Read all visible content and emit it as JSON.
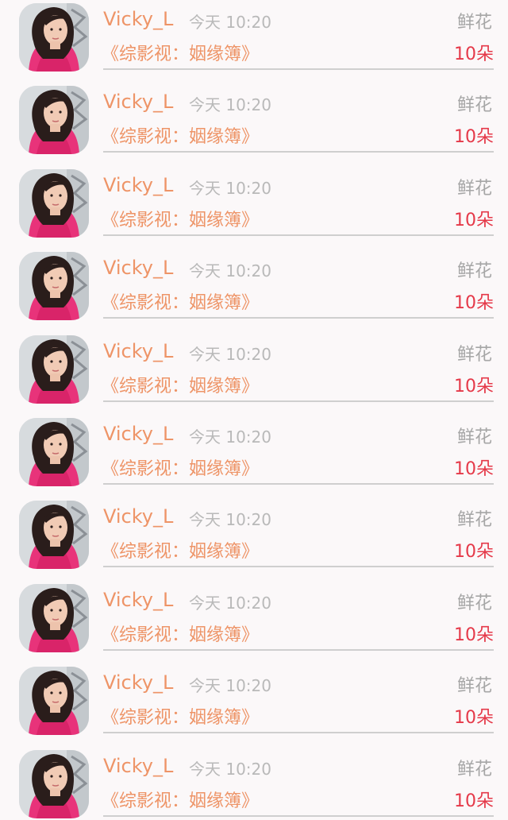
{
  "colors": {
    "background": "#fbf8f9",
    "name": "#ee9467",
    "title": "#ee9467",
    "time": "#b9b9b9",
    "type": "#a6a6a6",
    "amount": "#e53949",
    "divider": "#cfcfcf"
  },
  "records": [
    {
      "avatar_icon": "user-avatar-photo",
      "name": "Vicky_L",
      "time": "今天 10:20",
      "type": "鲜花",
      "title": "《综影视：姻缘簿》",
      "amount": "10朵"
    },
    {
      "avatar_icon": "user-avatar-photo",
      "name": "Vicky_L",
      "time": "今天 10:20",
      "type": "鲜花",
      "title": "《综影视：姻缘簿》",
      "amount": "10朵"
    },
    {
      "avatar_icon": "user-avatar-photo",
      "name": "Vicky_L",
      "time": "今天 10:20",
      "type": "鲜花",
      "title": "《综影视：姻缘簿》",
      "amount": "10朵"
    },
    {
      "avatar_icon": "user-avatar-photo",
      "name": "Vicky_L",
      "time": "今天 10:20",
      "type": "鲜花",
      "title": "《综影视：姻缘簿》",
      "amount": "10朵"
    },
    {
      "avatar_icon": "user-avatar-photo",
      "name": "Vicky_L",
      "time": "今天 10:20",
      "type": "鲜花",
      "title": "《综影视：姻缘簿》",
      "amount": "10朵"
    },
    {
      "avatar_icon": "user-avatar-photo",
      "name": "Vicky_L",
      "time": "今天 10:20",
      "type": "鲜花",
      "title": "《综影视：姻缘簿》",
      "amount": "10朵"
    },
    {
      "avatar_icon": "user-avatar-photo",
      "name": "Vicky_L",
      "time": "今天 10:20",
      "type": "鲜花",
      "title": "《综影视：姻缘簿》",
      "amount": "10朵"
    },
    {
      "avatar_icon": "user-avatar-photo",
      "name": "Vicky_L",
      "time": "今天 10:20",
      "type": "鲜花",
      "title": "《综影视：姻缘簿》",
      "amount": "10朵"
    },
    {
      "avatar_icon": "user-avatar-photo",
      "name": "Vicky_L",
      "time": "今天 10:20",
      "type": "鲜花",
      "title": "《综影视：姻缘簿》",
      "amount": "10朵"
    },
    {
      "avatar_icon": "user-avatar-photo",
      "name": "Vicky_L",
      "time": "今天 10:20",
      "type": "鲜花",
      "title": "《综影视：姻缘簿》",
      "amount": "10朵"
    }
  ]
}
